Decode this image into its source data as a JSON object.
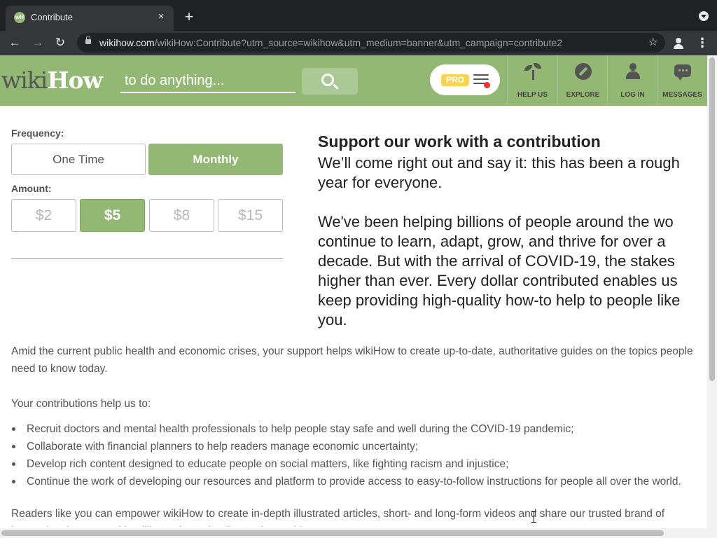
{
  "browser": {
    "tab_title": "Contribute",
    "tab_favicon": "wH",
    "tab_close": "×",
    "new_tab": "+",
    "url_host": "wikihow.com",
    "url_path": "/wikiHow:Contribute?utm_source=wikihow&utm_medium=banner&utm_campaign=contribute2",
    "back": "←",
    "forward": "→",
    "reload": "↻",
    "star": "☆",
    "menu": "⋮"
  },
  "header": {
    "logo_wiki": "wiki",
    "logo_how": "How",
    "search_placeholder": "to do anything...",
    "pro_label": "PRO",
    "nav": [
      {
        "label": "HELP US",
        "icon": "sprout-icon"
      },
      {
        "label": "EXPLORE",
        "icon": "compass-icon"
      },
      {
        "label": "LOG IN",
        "icon": "person-icon"
      },
      {
        "label": "MESSAGES",
        "icon": "chat-bubble-icon"
      }
    ]
  },
  "form": {
    "frequency_label": "Frequency:",
    "frequency_options": [
      "One Time",
      "Monthly"
    ],
    "frequency_selected": "Monthly",
    "amount_label": "Amount:",
    "amount_options": [
      "$2",
      "$5",
      "$8",
      "$15"
    ],
    "amount_selected": "$5"
  },
  "pitch": {
    "heading": "Support our work with a contribution",
    "lines1": [
      "We’ll come right out and say it: this has been a rough",
      "year for everyone."
    ],
    "lines2": [
      "We've been helping billions of people around the wo",
      "continue to learn, adapt, grow, and thrive for over a",
      "decade. But with the arrival of COVID-19, the stakes",
      "higher than ever. Every dollar contributed enables us",
      "keep providing high-quality how-to help to people like",
      "you."
    ]
  },
  "body": {
    "intro": "Amid the current public health and economic crises, your support helps wikiHow to create up-to-date, authoritative guides on the topics people need to know today.",
    "help_us_to": "Your contributions help us to:",
    "bullets": [
      "Recruit doctors and mental health professionals to help people stay safe and well during the COVID-19 pandemic;",
      "Collaborate with financial planners to help readers manage economic uncertainty;",
      "Develop rich content designed to educate people on social matters, like fighting racism and injustice;",
      "Continue the work of developing our resources and platform to provide access to easy-to-follow instructions for people all over the world."
    ],
    "closing": "Readers like you can empower wikiHow to create in-depth illustrated articles, short- and long-form videos and share our trusted brand of instructional content with millions of people all over the world."
  },
  "colors": {
    "brand_green": "#93b874",
    "chrome_dark": "#202124",
    "text_gray": "#545454"
  }
}
